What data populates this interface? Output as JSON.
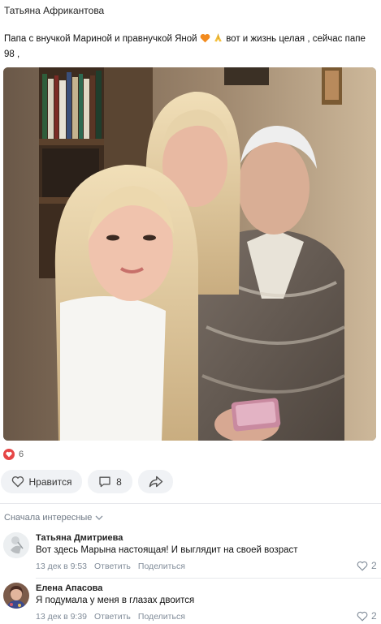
{
  "post": {
    "author": "Татьяна Африкантова",
    "text_part1": "Папа с внучкой Мариной и правнучкой Яной",
    "text_part2": "вот и жизнь целая , сейчас папе 98 ,",
    "emojis": [
      "orange-heart-icon",
      "folded-hands-icon"
    ]
  },
  "reactions": {
    "likes_count": "6"
  },
  "actions": {
    "like_label": "Нравится",
    "comments_count": "8"
  },
  "comments_sort": "Сначала интересные",
  "comments": [
    {
      "author": "Татьяна Дмитриева",
      "text": "Вот здесь Марына настоящая! И выглядит на своей возраст",
      "date": "13 дек в 9:53",
      "reply_label": "Ответить",
      "share_label": "Поделиться",
      "likes": "2"
    },
    {
      "author": "Елена Апасова",
      "text": "Я подумала у меня в глазах двоится",
      "date": "13 дек в 9:39",
      "reply_label": "Ответить",
      "share_label": "Поделиться",
      "likes": "2"
    }
  ],
  "colors": {
    "accent_red": "#e64646",
    "button_bg": "#f0f2f5",
    "meta_gray": "#818c99"
  }
}
